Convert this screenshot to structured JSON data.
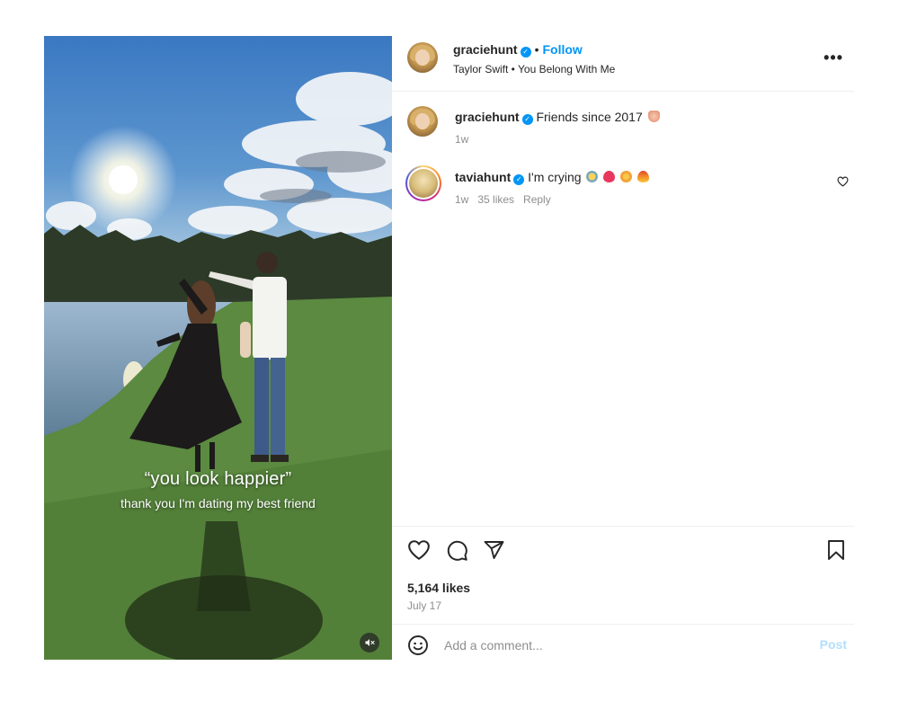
{
  "post": {
    "username": "graciehunt",
    "follow_label": "Follow",
    "audio": "Taylor Swift • You Belong With Me",
    "more_label": "•••"
  },
  "media": {
    "caption_big": "“you look happier”",
    "caption_small": "thank you I'm dating my best friend",
    "mute_icon": "speaker-muted-icon"
  },
  "comments": [
    {
      "username": "graciehunt",
      "text": "Friends since 2017",
      "emojis": [
        "heart-hands-emoji"
      ],
      "time": "1w"
    },
    {
      "username": "taviahunt",
      "text": "I'm crying",
      "emojis": [
        "crying-face-emoji",
        "heart-emoji",
        "heart-eyes-emoji",
        "fire-emoji"
      ],
      "time": "1w",
      "likes": "35 likes",
      "reply_label": "Reply"
    }
  ],
  "actions": {
    "icons": [
      "heart-icon",
      "comment-icon",
      "share-icon",
      "bookmark-icon"
    ],
    "likes": "5,164 likes",
    "date": "July 17"
  },
  "comment_box": {
    "placeholder": "Add a comment...",
    "post_label": "Post"
  },
  "colors": {
    "accent": "#0095f6",
    "post_disabled": "#b2dffc",
    "muted_text": "#8e8e8e",
    "divider": "#efefef"
  }
}
